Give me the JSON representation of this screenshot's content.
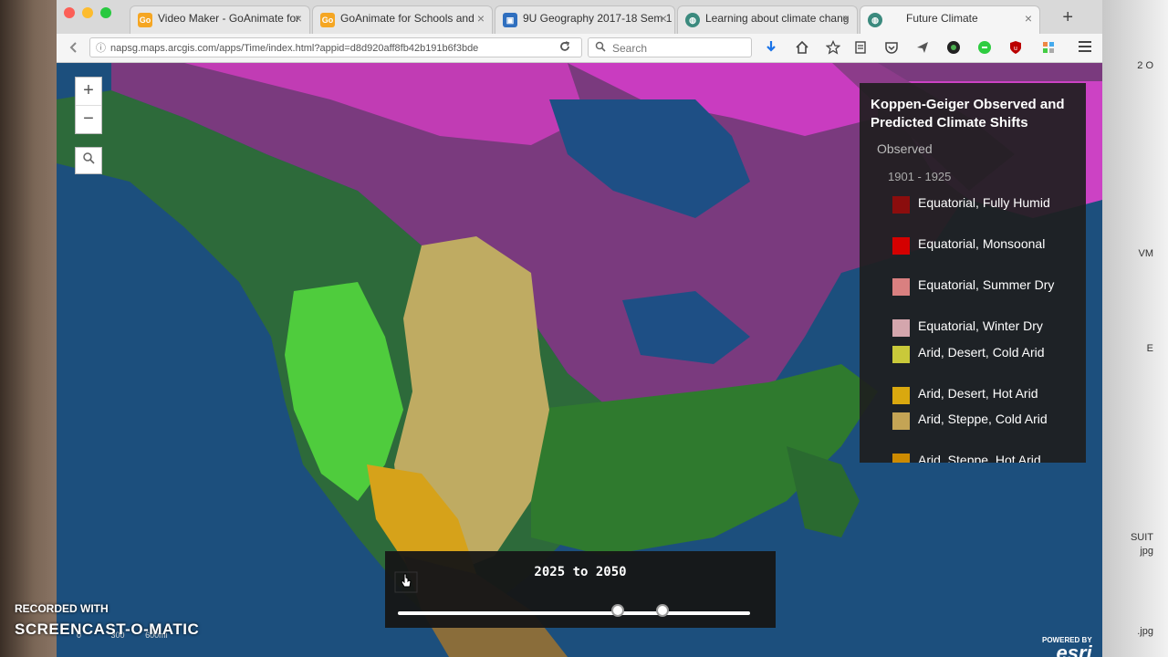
{
  "browser": {
    "tabs": [
      {
        "label": "Video Maker - GoAnimate for",
        "icon": "goanimate-icon"
      },
      {
        "label": "GoAnimate for Schools and",
        "icon": "goanimate-icon"
      },
      {
        "label": "9U Geography 2017-18 Sem 1",
        "icon": "classroom-icon"
      },
      {
        "label": "Learning about climate chang",
        "icon": "globe-icon"
      },
      {
        "label": "Future Climate",
        "icon": "globe-icon"
      }
    ],
    "url": "napsg.maps.arcgis.com/apps/Time/index.html?appid=d8d920aff8fb42b191b6f3bde",
    "search_placeholder": "Search"
  },
  "map": {
    "zoom_in": "+",
    "zoom_out": "−",
    "scale_labels": [
      "0",
      "300",
      "600mi"
    ]
  },
  "legend": {
    "title": "Koppen-Geiger Observed and Predicted Climate Shifts",
    "subtitle": "Observed",
    "period": "1901 - 1925",
    "items": [
      {
        "label": "Equatorial, Fully Humid",
        "color": "#8b0d0d"
      },
      {
        "label": "Equatorial, Monsoonal",
        "color": "#d40000"
      },
      {
        "label": "Equatorial, Summer Dry",
        "color": "#d98080"
      },
      {
        "label": "Equatorial, Winter Dry",
        "color": "#d4a6ad"
      },
      {
        "label": "Arid, Desert, Cold Arid",
        "color": "#c9c93a"
      },
      {
        "label": "Arid, Desert, Hot Arid",
        "color": "#d9a80f"
      },
      {
        "label": "Arid, Steppe, Cold Arid",
        "color": "#c4a455"
      },
      {
        "label": "Arid, Steppe, Hot Arid",
        "color": "#cc8a00"
      }
    ]
  },
  "time_slider": {
    "label": "2025 to 2050",
    "start_fraction": 0.625,
    "end_fraction": 0.75
  },
  "attribution": {
    "powered_by": "POWERED BY",
    "brand": "esri"
  },
  "watermark": {
    "recorded_with": "RECORDED WITH",
    "brand": "SCREENCAST-O-MATIC"
  },
  "desktop": {
    "right_labels": [
      "2 O",
      "VM",
      "E",
      "SUIT",
      "jpg",
      ".jpg"
    ]
  }
}
